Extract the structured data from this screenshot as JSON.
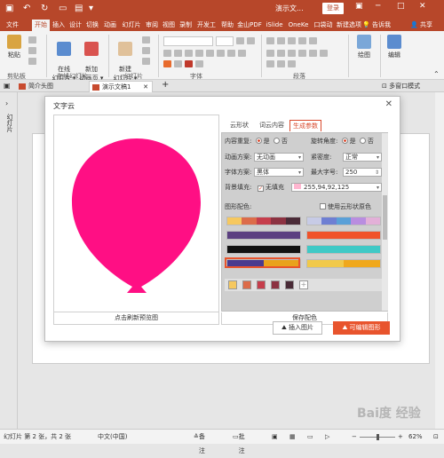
{
  "titlebar": {
    "doc_title": "演示文...",
    "login": "登录",
    "quick_access": [
      "💾",
      "↶",
      "↻",
      "▶"
    ],
    "win": [
      "🗖",
      "─",
      "□",
      "✕"
    ]
  },
  "ribbon_tabs": [
    "文件",
    "开始",
    "插入",
    "设计",
    "切换",
    "动画",
    "幻灯片",
    "审阅",
    "视图",
    "录制",
    "开发工",
    "帮助",
    "金山PDF",
    "iSlide",
    "OneKe",
    "口袋动",
    "新建选项"
  ],
  "tell_me": "告诉我",
  "share": "共享",
  "ribbon": {
    "paste": "粘贴",
    "clipboard": "剪贴板",
    "new_slide_online": "在线\n幻灯片 ▾",
    "new_animation_page": "新加\n动画页 ▾",
    "online_group": "在线幻灯片",
    "new_slide": "新建\n幻灯片 ▾",
    "slides_group": "幻灯片",
    "font_group": "字体",
    "paragraph_group": "段落",
    "draw": "绘图",
    "edit": "编辑"
  },
  "doc_tabs": [
    "简介头图",
    "演示文稿1"
  ],
  "multi_window": "多窗口模式",
  "left_pane_label": "幻灯片",
  "statusbar": {
    "slide_info": "幻灯片 第 2 张，共 2 张",
    "lang": "中文(中国)",
    "notes": "备注",
    "comments": "批注",
    "zoom": "62%"
  },
  "dialog": {
    "title": "文字云",
    "close": "✕",
    "preview_label": "点击刷新预览图",
    "tabs": [
      "云形状",
      "词云内容",
      "生成参数"
    ],
    "active_tab": 2,
    "content_repeat_label": "内容重复:",
    "yes": "是",
    "no": "否",
    "rotate_label": "旋转角度:",
    "animation_label": "动画方案:",
    "animation_value": "无动画",
    "density_label": "紧密度:",
    "density_value": "正常",
    "font_label": "字体方案:",
    "font_value": "黑体",
    "max_size_label": "最大字号:",
    "max_size_value": "250",
    "bg_fill_label": "背景填充:",
    "no_fill": "无填充",
    "bg_color_value": "255,94,92,125",
    "palette_label": "图形配色:",
    "use_shape_color": "使用云形状原色",
    "save_color": "保存配色",
    "insert_image": "插入图片",
    "editable_shape": "可编辑图形",
    "balloon_color": "#ff0f84",
    "palettes": [
      [
        "#f6c85f",
        "#dc6c4a",
        "#c63e4c",
        "#8c3241",
        "#4a2b37"
      ],
      [
        "#c7cbe6",
        "#6e7fd3",
        "#5aa0d8",
        "#b98de0",
        "#e3b0d8"
      ],
      [
        "#5b3f80",
        "#5b3f80"
      ],
      [
        "#f0522a",
        "#f0522a"
      ],
      [
        "#111111",
        "#111111"
      ],
      [
        "#3fc9c6",
        "#3fc9c6"
      ],
      [
        "#4a3a8e",
        "#e9a21b"
      ],
      [
        "#f1c94a",
        "#f0a81c"
      ]
    ],
    "chips": [
      "#f6c85f",
      "#dc6c4a",
      "#c63e4c",
      "#8c3241",
      "#4a2b37"
    ]
  },
  "watermark": "Bai度 经验"
}
